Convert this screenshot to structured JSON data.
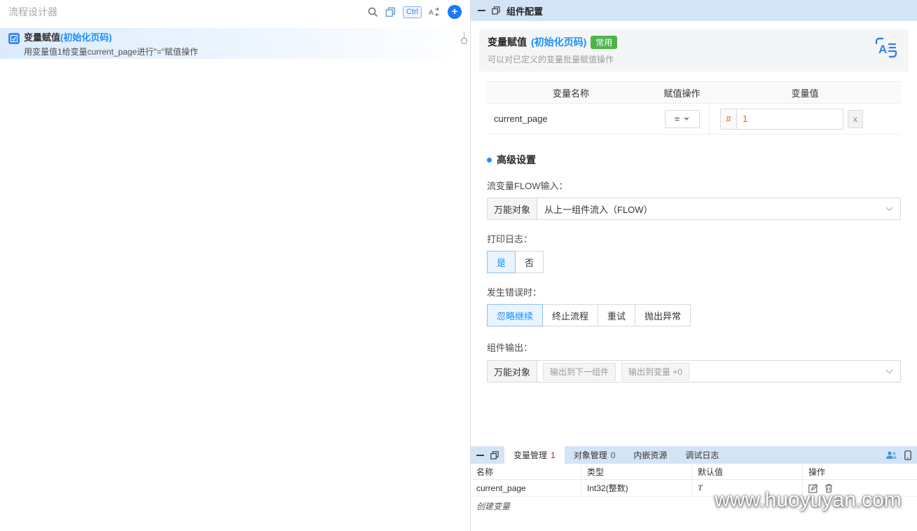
{
  "left_panel": {
    "title": "流程设计器",
    "toolbar": {
      "ctrl": "Ctrl",
      "plus": "+"
    },
    "flow_item": {
      "title": "变量赋值",
      "suffix": "(初始化页码)",
      "description": "用变量值1给变量current_page进行\"=\"赋值操作"
    }
  },
  "config_panel": {
    "header": "组件配置",
    "card": {
      "title": "变量赋值",
      "suffix": "(初始化页码)",
      "badge": "常用",
      "subtitle": "可以对已定义的变量批量赋值操作"
    },
    "table": {
      "headers": [
        "变量名称",
        "赋值操作",
        "变量值"
      ],
      "row": {
        "name": "current_page",
        "operator": "=",
        "prefix": "#",
        "value": "1",
        "clear": "x"
      }
    },
    "advanced": {
      "title": "高级设置",
      "flow_input_label": "流变量FLOW输入：",
      "flow_input_prefix": "万能对象",
      "flow_input_value": "从上一组件流入（FLOW）",
      "print_log_label": "打印日志：",
      "print_log_options": [
        "是",
        "否"
      ],
      "error_label": "发生错误时：",
      "error_options": [
        "忽略继续",
        "终止流程",
        "重试",
        "抛出异常"
      ],
      "output_label": "组件输出：",
      "output_prefix": "万能对象",
      "output_tags": [
        "输出到下一组件",
        "输出到变量 +0"
      ]
    }
  },
  "bottom_panel": {
    "tabs": [
      {
        "label": "变量管理",
        "count": "1"
      },
      {
        "label": "对象管理",
        "count": "0"
      },
      {
        "label": "内嵌资源"
      },
      {
        "label": "调试日志"
      }
    ],
    "table": {
      "headers": [
        "名称",
        "类型",
        "默认值",
        "操作"
      ],
      "row": {
        "name": "current_page",
        "type": "Int32(整数)",
        "default": "T"
      }
    },
    "create_label": "创建变量",
    "watermark": "www.huoyuyan.com"
  }
}
